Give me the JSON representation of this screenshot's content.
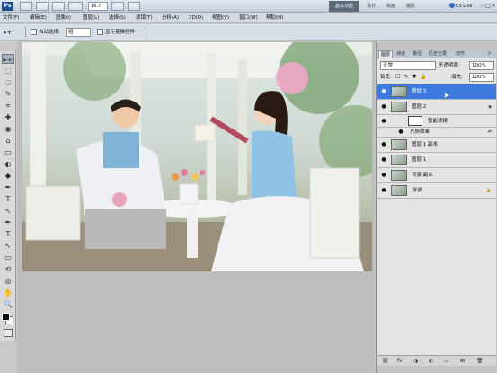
{
  "titlebar": {
    "logo": "Ps",
    "zoom": "16.7",
    "workspace_active": "基本功能",
    "workspaces": [
      "设计",
      "绘画",
      "摄影"
    ],
    "cs_live": "CS Live",
    "win_min": "–",
    "win_max": "□",
    "win_close": "×"
  },
  "menu": [
    "文件(F)",
    "编辑(E)",
    "图像(I)",
    "图层(L)",
    "选择(S)",
    "滤镜(T)",
    "分析(A)",
    "3D(D)",
    "视图(V)",
    "窗口(W)",
    "帮助(H)"
  ],
  "options": {
    "auto_select_label": "自动选择:",
    "auto_select_value": "组",
    "transform_label": "显示变换控件"
  },
  "tools": [
    "▸+",
    "⬚",
    "◌",
    "✎",
    "⌗",
    "✚",
    "◉",
    "⌂",
    "▭",
    "◐",
    "◆",
    "✒",
    "T",
    "↖",
    "▭",
    "✋",
    "🔍"
  ],
  "panel": {
    "tabs": [
      "图层",
      "通道",
      "路径",
      "历史记录",
      "动作"
    ],
    "blend_mode": "正常",
    "opacity_label": "不透明度:",
    "opacity_value": "100%",
    "lock_label": "锁定:",
    "lock_icons": "☐ ✎ ✚ 🔒",
    "fill_label": "填充:",
    "fill_value": "100%",
    "close": "×"
  },
  "layers": [
    {
      "name": "图层 3",
      "selected": true
    },
    {
      "name": "图层 2",
      "selected": false,
      "smart": true
    },
    {
      "name": "智能滤镜",
      "selected": false,
      "filter": true
    },
    {
      "name": "光照效果",
      "selected": false,
      "effect": true
    },
    {
      "name": "图层 1 副本",
      "selected": false
    },
    {
      "name": "图层 1",
      "selected": false
    },
    {
      "name": "背景 副本",
      "selected": false
    },
    {
      "name": "背景",
      "selected": false,
      "locked": true
    }
  ],
  "footer_icons": [
    "⛓",
    "fx",
    "◑",
    "◐",
    "▭",
    "⊞",
    "🗑"
  ]
}
